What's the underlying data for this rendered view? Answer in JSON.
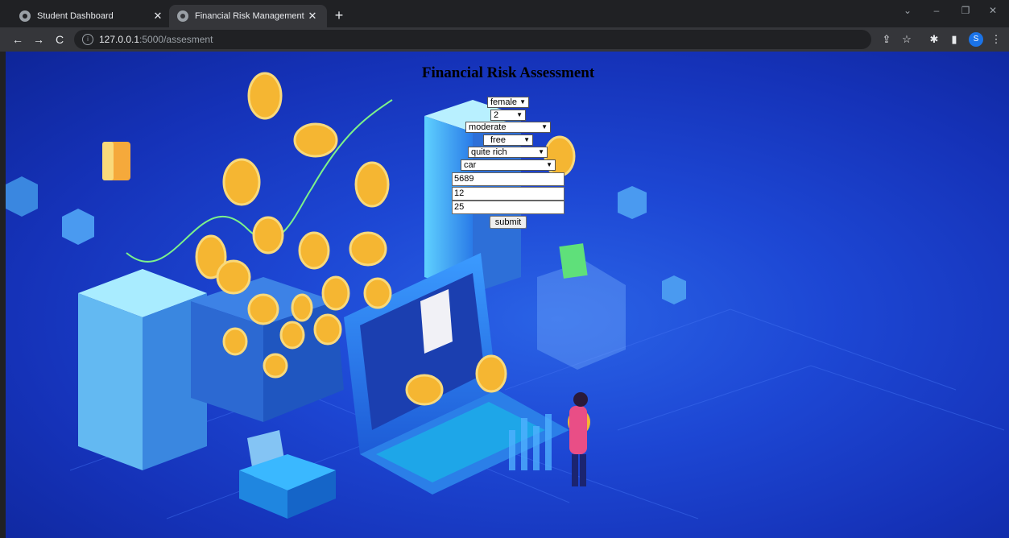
{
  "browser": {
    "tabs": [
      {
        "title": "Student Dashboard",
        "active": false
      },
      {
        "title": "Financial Risk Management",
        "active": true
      }
    ],
    "url_host": "127.0.0.1",
    "url_path": ":5000/assesment",
    "profile_initial": "S"
  },
  "page": {
    "heading": "Financial Risk Assessment",
    "selects": {
      "sex": "female",
      "job": "2",
      "housing": "moderate",
      "saving": "free",
      "checking": "quite rich",
      "purpose": "car"
    },
    "inputs": {
      "credit_amount": "5689",
      "duration": "12",
      "age": "25"
    },
    "submit_label": "submit"
  },
  "colors": {
    "background_accent": "#1d47d4",
    "coin": "#f5b632"
  }
}
